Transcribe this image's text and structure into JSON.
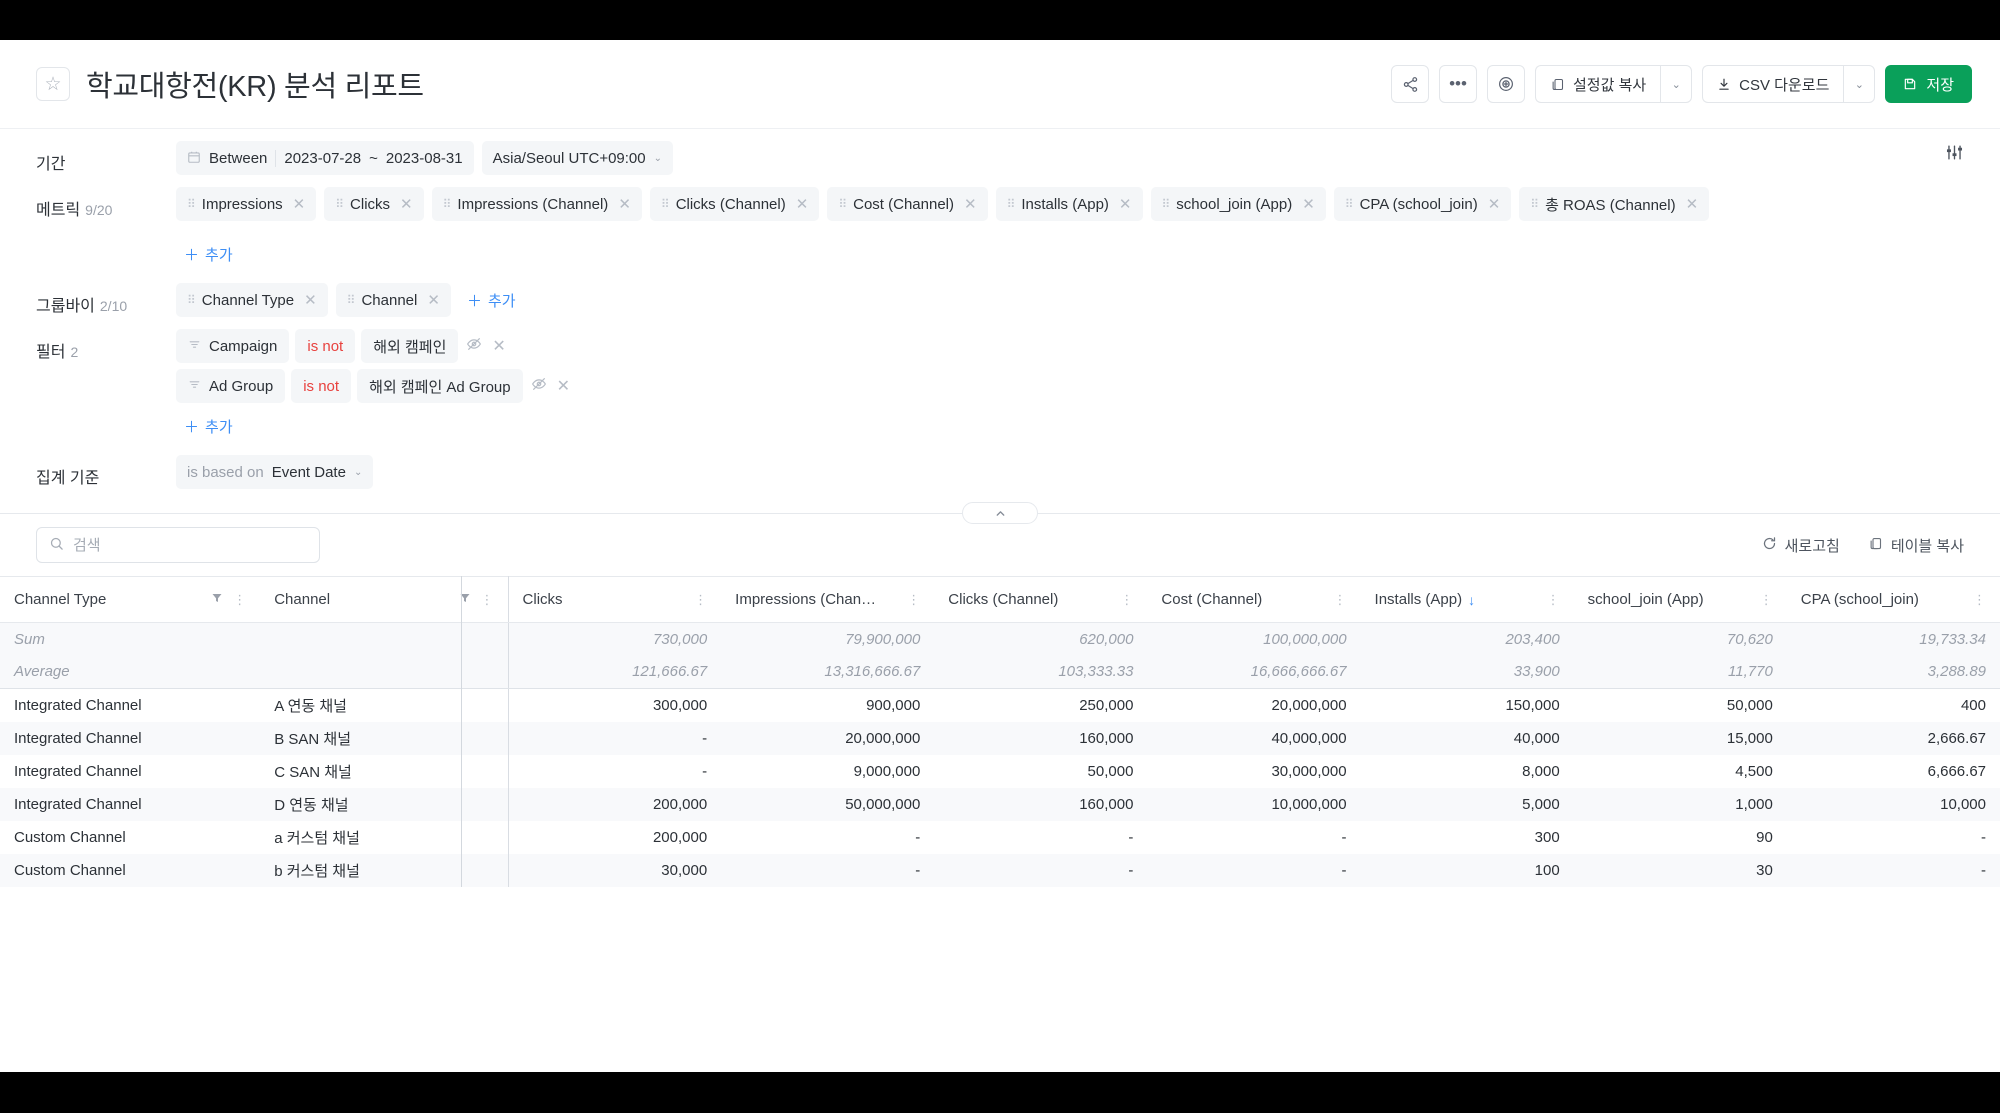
{
  "header": {
    "title": "학교대항전(KR) 분석 리포트",
    "star_icon": "star-icon",
    "share_icon": "share-icon",
    "more_icon": "ellipsis-icon",
    "target_icon": "target-icon",
    "copy_settings_label": "설정값 복사",
    "csv_download_label": "CSV 다운로드",
    "save_label": "저장",
    "caret": "⌄"
  },
  "config": {
    "period": {
      "label": "기간",
      "mode": "Between",
      "start_date": "2023-07-28",
      "range_sep": "~",
      "end_date": "2023-08-31",
      "timezone": "Asia/Seoul UTC+09:00"
    },
    "metrics": {
      "label": "메트릭",
      "count": "9/20",
      "items": [
        "Impressions",
        "Clicks",
        "Impressions (Channel)",
        "Clicks (Channel)",
        "Cost (Channel)",
        "Installs (App)",
        "school_join (App)",
        "CPA (school_join)",
        "총 ROAS (Channel)"
      ],
      "add_label": "추가"
    },
    "groupby": {
      "label": "그룹바이",
      "count": "2/10",
      "items": [
        "Channel Type",
        "Channel"
      ],
      "add_label": "추가"
    },
    "filters": {
      "label": "필터",
      "count": "2",
      "items": [
        {
          "field": "Campaign",
          "operator": "is not",
          "value": "해외 캠페인"
        },
        {
          "field": "Ad Group",
          "operator": "is not",
          "value": "해외 캠페인 Ad Group"
        }
      ],
      "add_label": "추가"
    },
    "aggregation": {
      "label": "집계 기준",
      "prefix": "is based on",
      "value": "Event Date"
    },
    "settings_icon": "settings-sliders-icon",
    "collapse_icon": "chevron-up-icon"
  },
  "table_toolbar": {
    "search_placeholder": "검색",
    "search_value": "",
    "refresh_label": "새로고침",
    "copy_table_label": "테이블 복사"
  },
  "table": {
    "columns": [
      {
        "label": "Channel Type",
        "numeric": false,
        "filter": true,
        "sort": ""
      },
      {
        "label": "Channel",
        "numeric": false,
        "filter": true,
        "sort": ""
      },
      {
        "label": "Clicks",
        "numeric": true,
        "filter": false,
        "sort": ""
      },
      {
        "label": "Impressions (Chan…",
        "numeric": true,
        "filter": false,
        "sort": ""
      },
      {
        "label": "Clicks (Channel)",
        "numeric": true,
        "filter": false,
        "sort": ""
      },
      {
        "label": "Cost (Channel)",
        "numeric": true,
        "filter": false,
        "sort": ""
      },
      {
        "label": "Installs (App)",
        "numeric": true,
        "filter": false,
        "sort": "↓"
      },
      {
        "label": "school_join (App)",
        "numeric": true,
        "filter": false,
        "sort": ""
      },
      {
        "label": "CPA (school_join)",
        "numeric": true,
        "filter": false,
        "sort": ""
      }
    ],
    "summary_rows": [
      {
        "label": "Sum",
        "values": [
          "730,000",
          "79,900,000",
          "620,000",
          "100,000,000",
          "203,400",
          "70,620",
          "19,733.34"
        ]
      },
      {
        "label": "Average",
        "values": [
          "121,666.67",
          "13,316,666.67",
          "103,333.33",
          "16,666,666.67",
          "33,900",
          "11,770",
          "3,288.89"
        ]
      }
    ],
    "rows": [
      {
        "channel_type": "Integrated Channel",
        "channel": "A 연동 채널",
        "values": [
          "300,000",
          "900,000",
          "250,000",
          "20,000,000",
          "150,000",
          "50,000",
          "400"
        ]
      },
      {
        "channel_type": "Integrated Channel",
        "channel": "B SAN 채널",
        "values": [
          "-",
          "20,000,000",
          "160,000",
          "40,000,000",
          "40,000",
          "15,000",
          "2,666.67"
        ]
      },
      {
        "channel_type": "Integrated Channel",
        "channel": "C SAN 채널",
        "values": [
          "-",
          "9,000,000",
          "50,000",
          "30,000,000",
          "8,000",
          "4,500",
          "6,666.67"
        ]
      },
      {
        "channel_type": "Integrated Channel",
        "channel": "D 연동 채널",
        "values": [
          "200,000",
          "50,000,000",
          "160,000",
          "10,000,000",
          "5,000",
          "1,000",
          "10,000"
        ]
      },
      {
        "channel_type": "Custom Channel",
        "channel": "a 커스텀 채널",
        "values": [
          "200,000",
          "-",
          "-",
          "-",
          "300",
          "90",
          "-"
        ]
      },
      {
        "channel_type": "Custom Channel",
        "channel": "b 커스텀 채널",
        "values": [
          "30,000",
          "-",
          "-",
          "-",
          "100",
          "30",
          "-"
        ]
      }
    ]
  },
  "colors": {
    "accent_green": "#0aa05a",
    "accent_blue": "#3d8ef5",
    "danger_red": "#e8423f",
    "chip_bg": "#f4f6f8"
  }
}
